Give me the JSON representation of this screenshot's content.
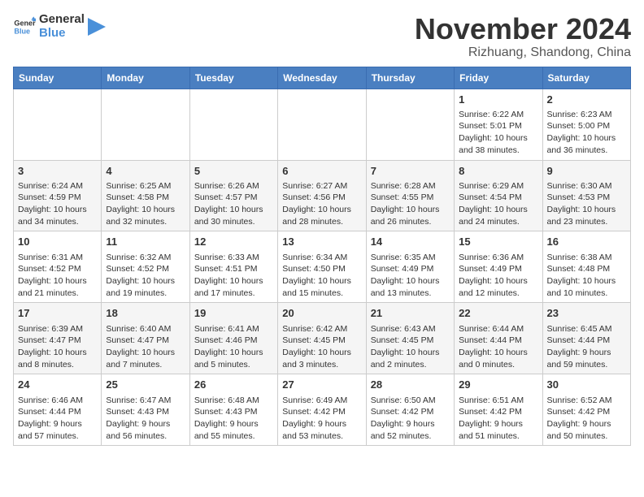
{
  "header": {
    "logo_general": "General",
    "logo_blue": "Blue",
    "month": "November 2024",
    "location": "Rizhuang, Shandong, China"
  },
  "days_of_week": [
    "Sunday",
    "Monday",
    "Tuesday",
    "Wednesday",
    "Thursday",
    "Friday",
    "Saturday"
  ],
  "weeks": [
    [
      {
        "day": "",
        "content": ""
      },
      {
        "day": "",
        "content": ""
      },
      {
        "day": "",
        "content": ""
      },
      {
        "day": "",
        "content": ""
      },
      {
        "day": "",
        "content": ""
      },
      {
        "day": "1",
        "content": "Sunrise: 6:22 AM\nSunset: 5:01 PM\nDaylight: 10 hours\nand 38 minutes."
      },
      {
        "day": "2",
        "content": "Sunrise: 6:23 AM\nSunset: 5:00 PM\nDaylight: 10 hours\nand 36 minutes."
      }
    ],
    [
      {
        "day": "3",
        "content": "Sunrise: 6:24 AM\nSunset: 4:59 PM\nDaylight: 10 hours\nand 34 minutes."
      },
      {
        "day": "4",
        "content": "Sunrise: 6:25 AM\nSunset: 4:58 PM\nDaylight: 10 hours\nand 32 minutes."
      },
      {
        "day": "5",
        "content": "Sunrise: 6:26 AM\nSunset: 4:57 PM\nDaylight: 10 hours\nand 30 minutes."
      },
      {
        "day": "6",
        "content": "Sunrise: 6:27 AM\nSunset: 4:56 PM\nDaylight: 10 hours\nand 28 minutes."
      },
      {
        "day": "7",
        "content": "Sunrise: 6:28 AM\nSunset: 4:55 PM\nDaylight: 10 hours\nand 26 minutes."
      },
      {
        "day": "8",
        "content": "Sunrise: 6:29 AM\nSunset: 4:54 PM\nDaylight: 10 hours\nand 24 minutes."
      },
      {
        "day": "9",
        "content": "Sunrise: 6:30 AM\nSunset: 4:53 PM\nDaylight: 10 hours\nand 23 minutes."
      }
    ],
    [
      {
        "day": "10",
        "content": "Sunrise: 6:31 AM\nSunset: 4:52 PM\nDaylight: 10 hours\nand 21 minutes."
      },
      {
        "day": "11",
        "content": "Sunrise: 6:32 AM\nSunset: 4:52 PM\nDaylight: 10 hours\nand 19 minutes."
      },
      {
        "day": "12",
        "content": "Sunrise: 6:33 AM\nSunset: 4:51 PM\nDaylight: 10 hours\nand 17 minutes."
      },
      {
        "day": "13",
        "content": "Sunrise: 6:34 AM\nSunset: 4:50 PM\nDaylight: 10 hours\nand 15 minutes."
      },
      {
        "day": "14",
        "content": "Sunrise: 6:35 AM\nSunset: 4:49 PM\nDaylight: 10 hours\nand 13 minutes."
      },
      {
        "day": "15",
        "content": "Sunrise: 6:36 AM\nSunset: 4:49 PM\nDaylight: 10 hours\nand 12 minutes."
      },
      {
        "day": "16",
        "content": "Sunrise: 6:38 AM\nSunset: 4:48 PM\nDaylight: 10 hours\nand 10 minutes."
      }
    ],
    [
      {
        "day": "17",
        "content": "Sunrise: 6:39 AM\nSunset: 4:47 PM\nDaylight: 10 hours\nand 8 minutes."
      },
      {
        "day": "18",
        "content": "Sunrise: 6:40 AM\nSunset: 4:47 PM\nDaylight: 10 hours\nand 7 minutes."
      },
      {
        "day": "19",
        "content": "Sunrise: 6:41 AM\nSunset: 4:46 PM\nDaylight: 10 hours\nand 5 minutes."
      },
      {
        "day": "20",
        "content": "Sunrise: 6:42 AM\nSunset: 4:45 PM\nDaylight: 10 hours\nand 3 minutes."
      },
      {
        "day": "21",
        "content": "Sunrise: 6:43 AM\nSunset: 4:45 PM\nDaylight: 10 hours\nand 2 minutes."
      },
      {
        "day": "22",
        "content": "Sunrise: 6:44 AM\nSunset: 4:44 PM\nDaylight: 10 hours\nand 0 minutes."
      },
      {
        "day": "23",
        "content": "Sunrise: 6:45 AM\nSunset: 4:44 PM\nDaylight: 9 hours\nand 59 minutes."
      }
    ],
    [
      {
        "day": "24",
        "content": "Sunrise: 6:46 AM\nSunset: 4:44 PM\nDaylight: 9 hours\nand 57 minutes."
      },
      {
        "day": "25",
        "content": "Sunrise: 6:47 AM\nSunset: 4:43 PM\nDaylight: 9 hours\nand 56 minutes."
      },
      {
        "day": "26",
        "content": "Sunrise: 6:48 AM\nSunset: 4:43 PM\nDaylight: 9 hours\nand 55 minutes."
      },
      {
        "day": "27",
        "content": "Sunrise: 6:49 AM\nSunset: 4:42 PM\nDaylight: 9 hours\nand 53 minutes."
      },
      {
        "day": "28",
        "content": "Sunrise: 6:50 AM\nSunset: 4:42 PM\nDaylight: 9 hours\nand 52 minutes."
      },
      {
        "day": "29",
        "content": "Sunrise: 6:51 AM\nSunset: 4:42 PM\nDaylight: 9 hours\nand 51 minutes."
      },
      {
        "day": "30",
        "content": "Sunrise: 6:52 AM\nSunset: 4:42 PM\nDaylight: 9 hours\nand 50 minutes."
      }
    ]
  ]
}
